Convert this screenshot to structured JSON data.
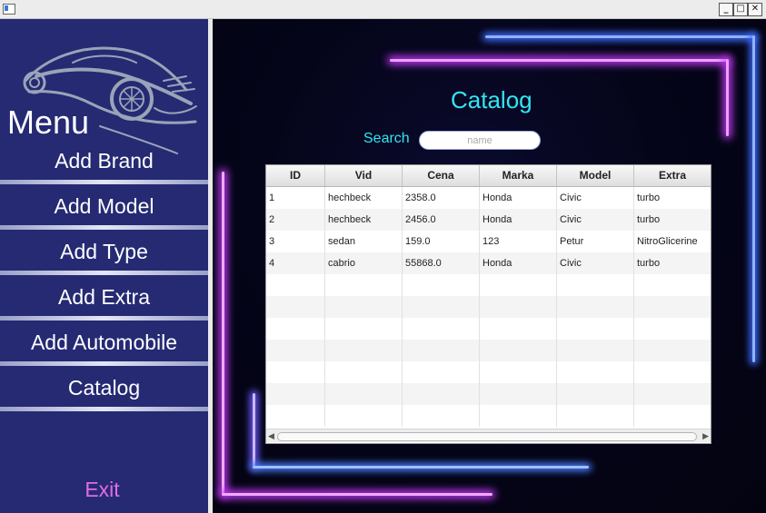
{
  "window": {
    "min_glyph": "_",
    "max_glyph": "□",
    "close_glyph": "✕"
  },
  "sidebar": {
    "title": "Menu",
    "items": [
      {
        "label": "Add Brand"
      },
      {
        "label": "Add Model"
      },
      {
        "label": "Add Type"
      },
      {
        "label": "Add Extra"
      },
      {
        "label": "Add Automobile"
      },
      {
        "label": "Catalog"
      }
    ],
    "exit_label": "Exit"
  },
  "main": {
    "title": "Catalog",
    "search_label": "Search",
    "search_placeholder": "name",
    "search_value": ""
  },
  "table": {
    "columns": [
      "ID",
      "Vid",
      "Cena",
      "Marka",
      "Model",
      "Extra"
    ],
    "rows": [
      [
        "1",
        "hechbeck",
        "2358.0",
        "Honda",
        "Civic",
        "turbo"
      ],
      [
        "2",
        "hechbeck",
        "2456.0",
        "Honda",
        "Civic",
        "turbo"
      ],
      [
        "3",
        "sedan",
        "159.0",
        "123",
        "Petur",
        "NitroGlicerine"
      ],
      [
        "4",
        "cabrio",
        "55868.0",
        "Honda",
        "Civic",
        "turbo"
      ]
    ]
  },
  "colors": {
    "sidebar_bg": "#252a73",
    "accent_cyan": "#31e6f2",
    "exit_pink": "#e16ce8",
    "neon_purple": "#c83cff",
    "neon_blue": "#4a7dff"
  },
  "icons": {
    "logo": "sports-car-logo-icon"
  }
}
